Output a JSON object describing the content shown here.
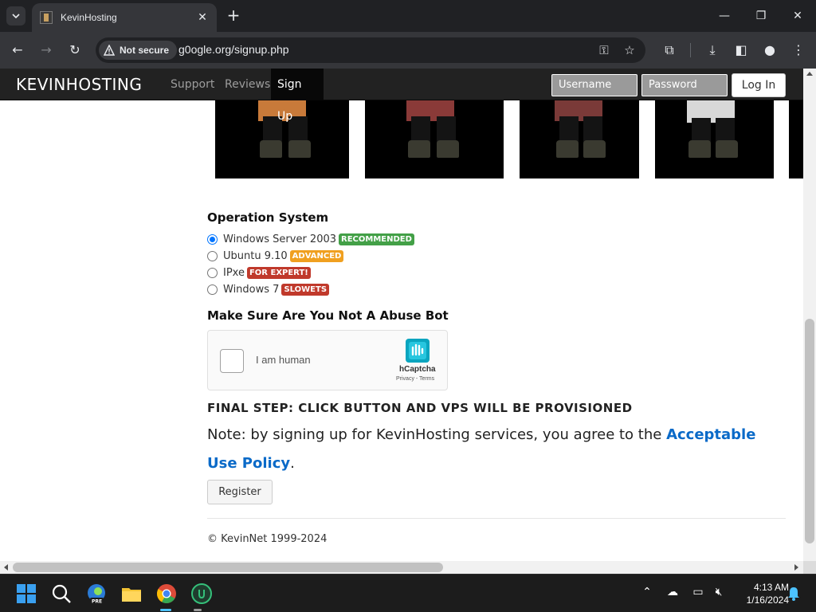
{
  "browser": {
    "tab_title": "KevinHosting",
    "new_tab": "+",
    "security_label": "Not secure",
    "url": "g0ogle.org/signup.php"
  },
  "site": {
    "brand": "KEVINHOSTING",
    "nav": [
      {
        "label": "Support"
      },
      {
        "label": "Reviews"
      },
      {
        "label": "Sign Up",
        "active": true
      }
    ],
    "username_placeholder": "Username",
    "password_placeholder": "Password",
    "login_label": "Log In"
  },
  "os_section": {
    "heading": "Operation System",
    "options": [
      {
        "label": "Windows Server 2003",
        "badge": "RECOMMENDED",
        "badge_color": "#43a047",
        "checked": true
      },
      {
        "label": "Ubuntu 9.10",
        "badge": "ADVANCED",
        "badge_color": "#f0a020",
        "checked": false
      },
      {
        "label": "IPxe",
        "badge": "FOR EXPERT!",
        "badge_color": "#c0392b",
        "checked": false
      },
      {
        "label": "Windows 7",
        "badge": "SLOWETS",
        "badge_color": "#c0392b",
        "checked": false
      }
    ]
  },
  "captcha_section": {
    "heading": "Make Sure Are You Not A Abuse Bot",
    "checkbox_label": "I am human",
    "brand": "hCaptcha",
    "links": "Privacy - Terms"
  },
  "final": {
    "step_text": "FINAL STEP: CLICK BUTTON AND VPS WILL BE PROVISIONED",
    "note_prefix": "Note: by signing up for KevinHosting services, you agree to the ",
    "note_link": "Acceptable Use Policy",
    "note_suffix": ".",
    "register_label": "Register"
  },
  "footer": {
    "copyright": "© KevinNet 1999-2024"
  },
  "taskbar": {
    "time": "4:13 AM",
    "date": "1/16/2024",
    "edge_badge": "PRE"
  },
  "colors": {
    "link": "#0a6ac8",
    "navbar": "#222222",
    "selected_radio": "#0075ff"
  }
}
